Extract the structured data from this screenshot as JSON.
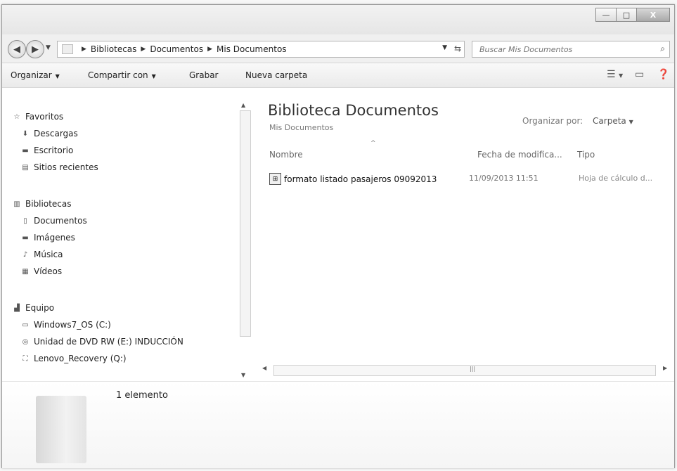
{
  "window": {
    "caption": {
      "minimize": "—",
      "maximize": "□",
      "close": "X"
    }
  },
  "address": {
    "breadcrumbs": [
      "Bibliotecas",
      "Documentos",
      "Mis Documentos"
    ],
    "search_placeholder": "Buscar Mis Documentos"
  },
  "toolbar": {
    "organize": "Organizar",
    "share": "Compartir con",
    "burn": "Grabar",
    "new_folder": "Nueva carpeta"
  },
  "sidebar": {
    "favorites": {
      "label": "Favoritos",
      "items": [
        "Descargas",
        "Escritorio",
        "Sitios recientes"
      ]
    },
    "libraries": {
      "label": "Bibliotecas",
      "items": [
        "Documentos",
        "Imágenes",
        "Música",
        "Vídeos"
      ]
    },
    "computer": {
      "label": "Equipo",
      "items": [
        "Windows7_OS (C:)",
        "Unidad de DVD RW (E:) INDUCCIÓN",
        "Lenovo_Recovery (Q:)"
      ]
    }
  },
  "main": {
    "library_title": "Biblioteca Documentos",
    "library_subtitle": "Mis Documentos",
    "arrange_label": "Organizar por:",
    "arrange_value": "Carpeta",
    "columns": {
      "name": "Nombre",
      "date": "Fecha de modifica...",
      "type": "Tipo"
    },
    "files": [
      {
        "name": "formato listado pasajeros 09092013",
        "date": "11/09/2013 11:51",
        "type": "Hoja de cálculo d..."
      }
    ]
  },
  "details": {
    "count": "1 elemento"
  },
  "icons": {
    "back": "back-arrow-icon",
    "forward": "forward-arrow-icon",
    "search": "search-icon",
    "views": "views-icon",
    "preview": "preview-pane-icon",
    "help": "help-icon"
  }
}
